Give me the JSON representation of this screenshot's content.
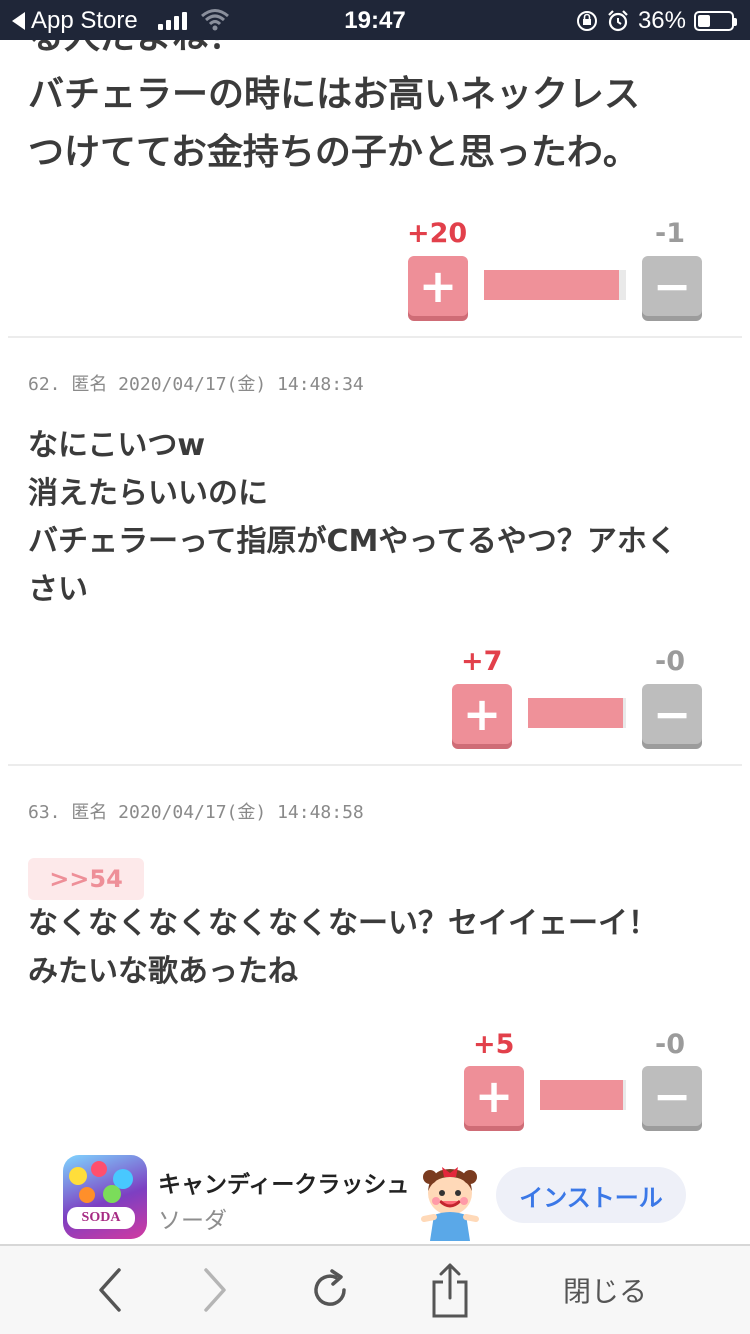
{
  "status_bar": {
    "back_app": "App Store",
    "time": "19:47",
    "battery": "36%"
  },
  "top_comment": {
    "lines": [
      "る人だよね！",
      "バチェラーの時にはお高いネックレス",
      "つけててお金持ちの子かと思ったわ。"
    ],
    "votes": {
      "plus": "+20",
      "minus": "-1",
      "ratio": 0.95
    }
  },
  "comments": [
    {
      "meta": "62. 匿名 2020/04/17(金) 14:48:34",
      "lines": [
        "なにこいつw",
        "消えたらいいのに",
        "バチェラーって指原がCMやってるやつ？アホく",
        "さい"
      ],
      "votes": {
        "plus": "+7",
        "minus": "-0",
        "ratio": 0.97
      }
    },
    {
      "meta": "63. 匿名 2020/04/17(金) 14:48:58",
      "reply": ">>54",
      "lines": [
        "なくなくなくなくなくなーい？セイイェーイ！",
        "みたいな歌あったね"
      ],
      "votes": {
        "plus": "+5",
        "minus": "-0",
        "ratio": 0.96
      }
    }
  ],
  "ad": {
    "title": "キャンディークラッシュ",
    "subtitle": "ソーダ",
    "icon_text": "SODA",
    "button": "インストール"
  },
  "toolbar": {
    "close": "閉じる"
  },
  "colors": {
    "statusbar": "#1f2638",
    "plus": "#e2404b",
    "plus_button": "#ee8f98",
    "minus_button": "#bdbdbd",
    "install_text": "#3b78e7"
  }
}
